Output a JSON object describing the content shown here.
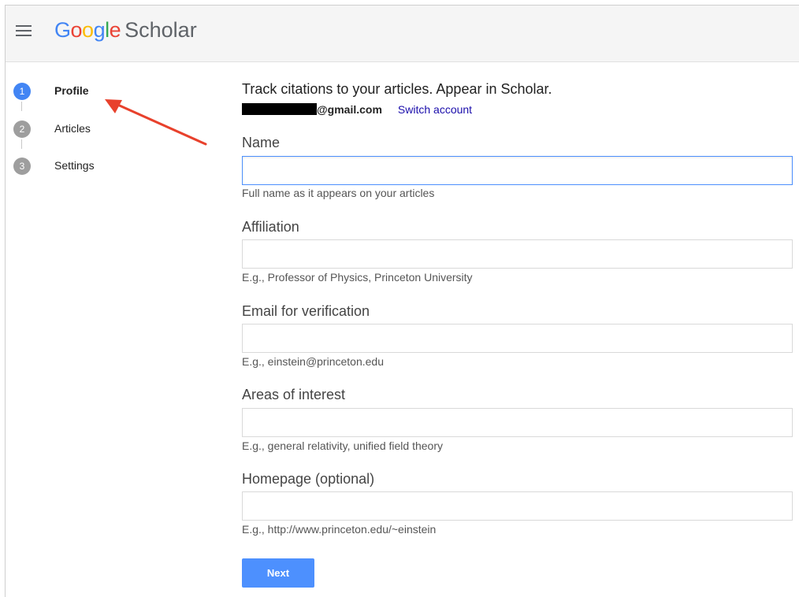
{
  "header": {
    "logo_letters": [
      {
        "char": "G",
        "color": "#4285f4"
      },
      {
        "char": "o",
        "color": "#ea4335"
      },
      {
        "char": "o",
        "color": "#fbbc05"
      },
      {
        "char": "g",
        "color": "#4285f4"
      },
      {
        "char": "l",
        "color": "#34a853"
      },
      {
        "char": "e",
        "color": "#ea4335"
      }
    ],
    "product_name": "Scholar",
    "menu_icon": "hamburger-menu-icon"
  },
  "steps": [
    {
      "number": "1",
      "label": "Profile",
      "active": true,
      "color": "#4285f4"
    },
    {
      "number": "2",
      "label": "Articles",
      "active": false,
      "color": "#9e9e9e"
    },
    {
      "number": "3",
      "label": "Settings",
      "active": false,
      "color": "#9e9e9e"
    }
  ],
  "annotation": {
    "arrow_color": "#e8412c"
  },
  "form": {
    "tagline": "Track citations to your articles. Appear in Scholar.",
    "account_email_domain": "@gmail.com",
    "switch_account": "Switch account",
    "fields": [
      {
        "label": "Name",
        "value": "",
        "hint": "Full name as it appears on your articles",
        "focused": true
      },
      {
        "label": "Affiliation",
        "value": "",
        "hint": "E.g., Professor of Physics, Princeton University",
        "focused": false
      },
      {
        "label": "Email for verification",
        "value": "",
        "hint": "E.g., einstein@princeton.edu",
        "focused": false
      },
      {
        "label": "Areas of interest",
        "value": "",
        "hint": "E.g., general relativity, unified field theory",
        "focused": false
      },
      {
        "label": "Homepage (optional)",
        "value": "",
        "hint": "E.g., http://www.princeton.edu/~einstein",
        "focused": false
      }
    ],
    "next_button": "Next"
  },
  "colors": {
    "accent": "#4d90fe",
    "link": "#1a0dab"
  }
}
